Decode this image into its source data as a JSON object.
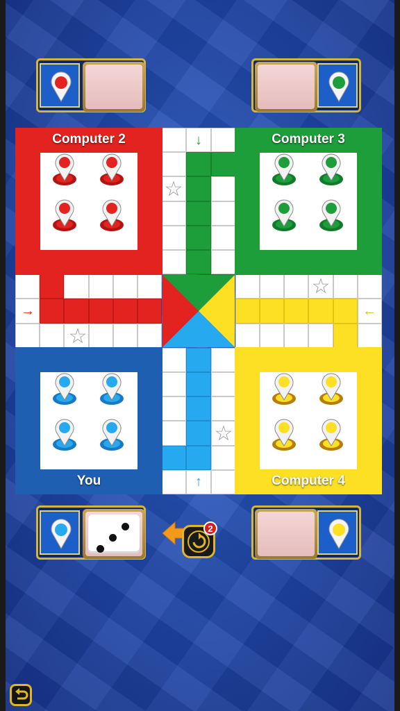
{
  "players": {
    "top_left": {
      "name": "Computer 2",
      "color": "#e3231f"
    },
    "top_right": {
      "name": "Computer 3",
      "color": "#1e9e3a"
    },
    "bottom_left": {
      "name": "You",
      "color": "#1f5fb2"
    },
    "bottom_right": {
      "name": "Computer 4",
      "color": "#fde024"
    }
  },
  "dice": {
    "value": 3
  },
  "undo": {
    "badge": "2"
  },
  "icons": {
    "start_arrow_red": "→",
    "start_arrow_green": "↓",
    "start_arrow_yellow": "←",
    "start_arrow_blue": "↑",
    "safe_star": "☆"
  },
  "colors": {
    "red": "#e3231f",
    "green": "#1e9e3a",
    "yellow": "#fde024",
    "blue": "#26a9ef",
    "you_yard": "#1f5fb2"
  }
}
